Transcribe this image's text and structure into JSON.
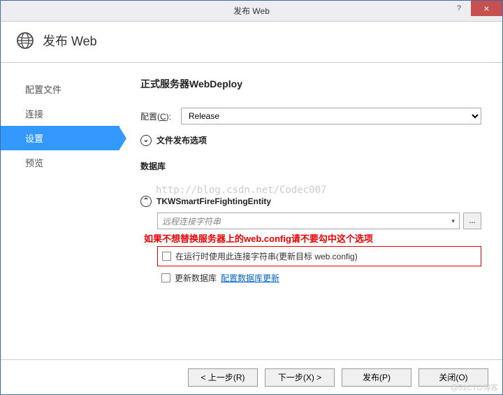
{
  "titlebar": {
    "title": "发布 Web",
    "help": "?",
    "close": "×"
  },
  "header": {
    "title": "发布 Web"
  },
  "sidebar": {
    "items": [
      {
        "label": "配置文件",
        "active": false
      },
      {
        "label": "连接",
        "active": false
      },
      {
        "label": "设置",
        "active": true
      },
      {
        "label": "预览",
        "active": false
      }
    ]
  },
  "main": {
    "profile_title": "正式服务器WebDeploy",
    "config_label_pre": "配置(",
    "config_label_u": "C",
    "config_label_post": "):",
    "config_value": "Release",
    "file_pub_options": "文件发布选项",
    "db_section": "数据库",
    "watermark": "http://blog.csdn.net/Codec007",
    "entity_name": "TKWSmartFireFightingEntity",
    "combo_placeholder": "远程连接字符串",
    "browse": "...",
    "annotation": "如果不想替换服务器上的web.config请不要勾中这个选项",
    "checkbox1": "在运行时使用此连接字符串(更新目标 web.config)",
    "checkbox2_label": "更新数据库",
    "checkbox2_link": "配置数据库更新"
  },
  "footer": {
    "prev": "< 上一步(R)",
    "next": "下一步(X) >",
    "publish": "发布(P)",
    "close": "关闭(O)"
  },
  "corner_wm": "@51CTO博客"
}
